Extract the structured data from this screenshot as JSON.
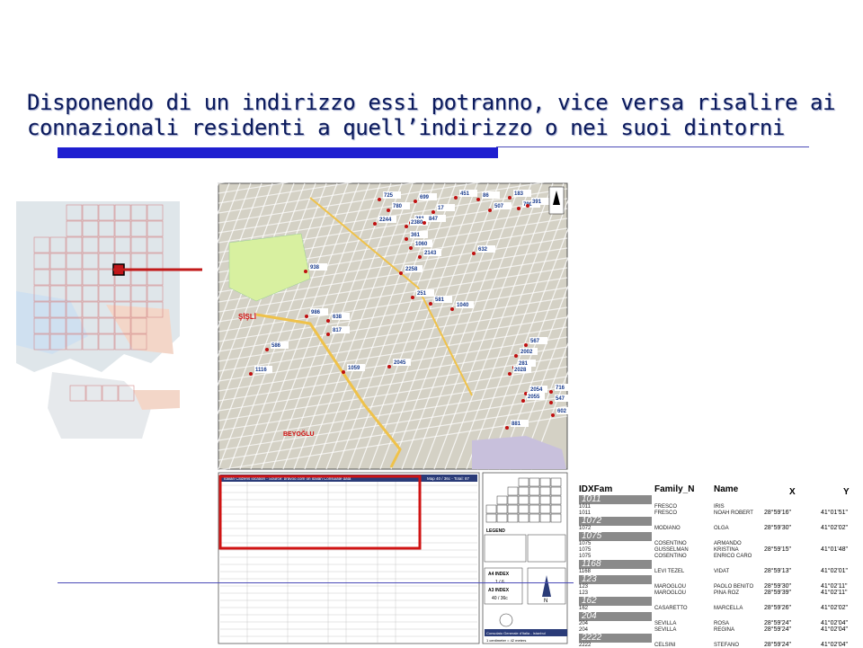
{
  "slide": {
    "title_line1": "Disponendo di un indirizzo essi potranno, vice versa risalire ai",
    "title_line2": "connazionali residenti a quell’indirizzo o nei suoi dintorni"
  },
  "map": {
    "district_label_1": "ŞİŞLİ",
    "district_label_2": "BEYOĞLU",
    "markers": [
      "725",
      "699",
      "451",
      "86",
      "183",
      "780",
      "17",
      "507",
      "790",
      "391",
      "2244",
      "281",
      "2380",
      "847",
      "361",
      "1060",
      "2143",
      "632",
      "938",
      "2258",
      "251",
      "581",
      "1040",
      "986",
      "638",
      "817",
      "586",
      "1059",
      "2045",
      "567",
      "2002",
      "281",
      "2028",
      "1116",
      "2054",
      "2055",
      "716",
      "547",
      "881",
      "602"
    ],
    "table_title": "Italian Citizens location - Source: bravoo.com on Italian Consulate data",
    "table_map_label": "Map 40 / 36c - Total: 87",
    "index_label_1": "A4 INDEX",
    "index_value_1": "1 / 6",
    "index_label_2": "A3 INDEX",
    "index_value_2": "40 / 36c",
    "consulate": "Consolato Generale d'Italia - Istanbul",
    "scale": "1 centimeter = 42 meters",
    "legend_title": "LEGEND",
    "north": "N"
  },
  "table": {
    "headers": [
      "IDXFam",
      "Family_N",
      "Name",
      "X",
      "Y"
    ],
    "groups": [
      {
        "idx": "1011",
        "rows": [
          [
            "1011",
            "FRESCO",
            "IRIS",
            "",
            ""
          ],
          [
            "1011",
            "FRESCO",
            "NOAH ROBERT",
            "28°59'16\"",
            "41°01'51\""
          ]
        ]
      },
      {
        "idx": "1072",
        "rows": [
          [
            "1072",
            "MODIANO",
            "OLGA",
            "28°59'30\"",
            "41°02'02\""
          ]
        ]
      },
      {
        "idx": "1075",
        "rows": [
          [
            "1075",
            "COSENTINO",
            "ARMANDO",
            "",
            ""
          ],
          [
            "1075",
            "GUSSELMAN",
            "KRISTINA",
            "28°59'15\"",
            "41°01'48\""
          ],
          [
            "1075",
            "COSENTINO",
            "ENRICO CARO",
            "",
            ""
          ]
        ]
      },
      {
        "idx": "1168",
        "rows": [
          [
            "1168",
            "LEVI TEZEL",
            "VIDAT",
            "28°59'13\"",
            "41°02'01\""
          ]
        ]
      },
      {
        "idx": "123",
        "rows": [
          [
            "123",
            "MAROGLOU",
            "PAOLO BENITO",
            "28°59'30\"",
            "41°02'11\""
          ],
          [
            "123",
            "MAROGLOU",
            "PINA ROZ",
            "28°59'39\"",
            "41°02'11\""
          ]
        ]
      },
      {
        "idx": "162",
        "rows": [
          [
            "162",
            "CASARETTO",
            "MARCELLA",
            "28°59'26\"",
            "41°02'02\""
          ]
        ]
      },
      {
        "idx": "204",
        "rows": [
          [
            "204",
            "SEVILLA",
            "ROSA",
            "28°59'24\"",
            "41°02'04\""
          ],
          [
            "204",
            "SEVILLA",
            "REGINA",
            "28°59'24\"",
            "41°02'04\""
          ]
        ]
      },
      {
        "idx": "2222",
        "rows": [
          [
            "2222",
            "CELSINI",
            "STEFANO",
            "28°59'24\"",
            "41°02'04\""
          ]
        ]
      }
    ]
  },
  "colors": {
    "title": "#0b1a5c",
    "bar": "#1f1fd0",
    "highlight": "#cc1a1a",
    "map_bg": "#d8d5c8",
    "park": "#d8f0a0"
  }
}
